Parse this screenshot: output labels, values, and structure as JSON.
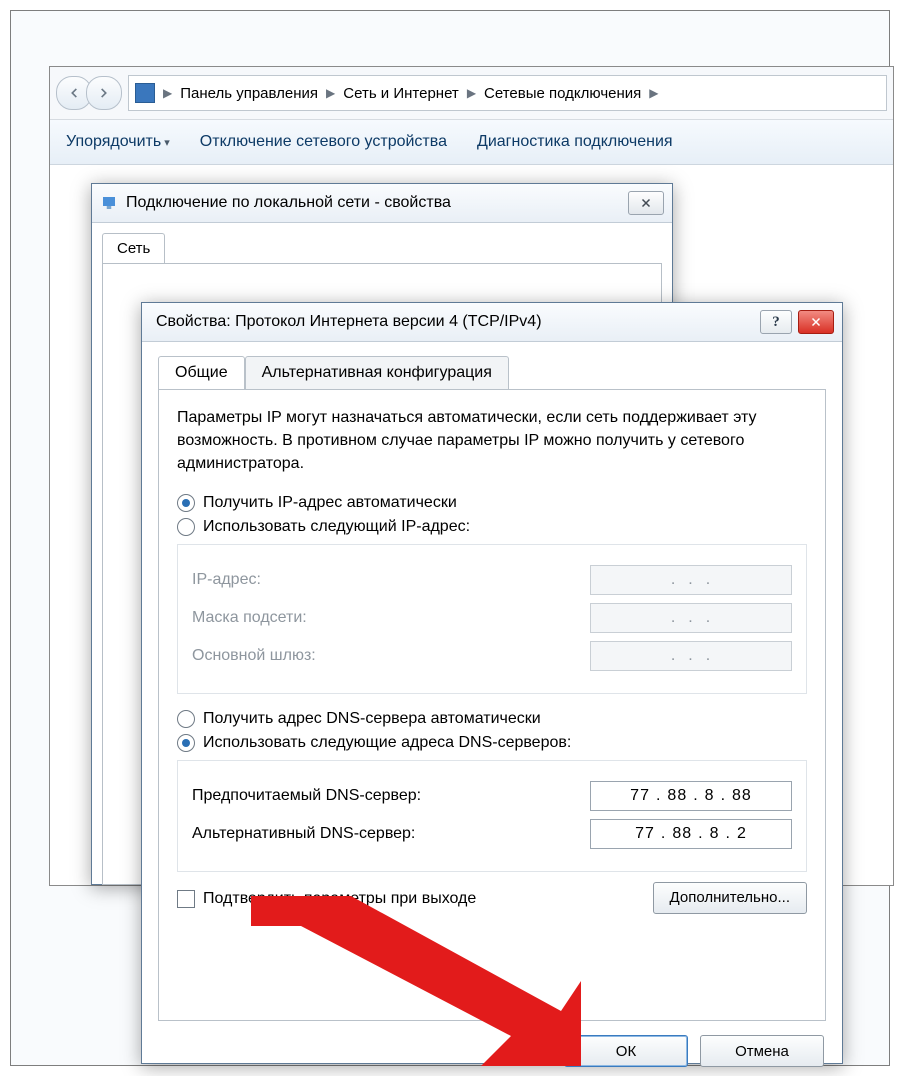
{
  "explorer": {
    "breadcrumb": [
      "Панель управления",
      "Сеть и Интернет",
      "Сетевые подключения"
    ],
    "toolbar": {
      "organize": "Упорядочить",
      "disable": "Отключение сетевого устройства",
      "diagnose": "Диагностика подключения"
    }
  },
  "props_window": {
    "title": "Подключение по локальной сети - свойства",
    "tab_network": "Сеть"
  },
  "ipv4": {
    "title": "Свойства: Протокол Интернета версии 4 (TCP/IPv4)",
    "tab_general": "Общие",
    "tab_alt": "Альтернативная конфигурация",
    "desc": "Параметры IP могут назначаться автоматически, если сеть поддерживает эту возможность. В противном случае параметры IP можно получить у сетевого администратора.",
    "ip_auto": "Получить IP-адрес автоматически",
    "ip_manual": "Использовать следующий IP-адрес:",
    "ip_label": "IP-адрес:",
    "mask_label": "Маска подсети:",
    "gw_label": "Основной шлюз:",
    "dns_auto": "Получить адрес DNS-сервера автоматически",
    "dns_manual": "Использовать следующие адреса DNS-серверов:",
    "dns_pref_label": "Предпочитаемый DNS-сервер:",
    "dns_alt_label": "Альтернативный DNS-сервер:",
    "dns_pref": {
      "a": "77",
      "b": "88",
      "c": "8",
      "d": "88"
    },
    "dns_alt": {
      "a": "77",
      "b": "88",
      "c": "8",
      "d": "2"
    },
    "validate": "Подтвердить параметры при выходе",
    "advanced": "Дополнительно...",
    "ok": "ОК",
    "cancel": "Отмена",
    "help": "?"
  }
}
